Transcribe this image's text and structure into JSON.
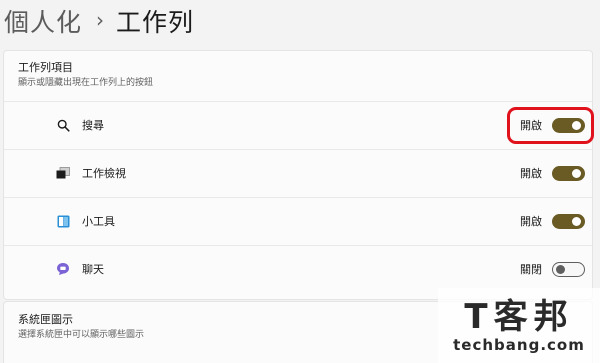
{
  "breadcrumb": {
    "parent": "個人化",
    "separator": "›",
    "current": "工作列"
  },
  "taskbar_items": {
    "title": "工作列項目",
    "description": "顯示或隱藏出現在工作列上的按鈕",
    "rows": [
      {
        "label": "搜尋",
        "icon": "search-icon",
        "state": "開啟",
        "on": true
      },
      {
        "label": "工作檢視",
        "icon": "task-view-icon",
        "state": "開啟",
        "on": true
      },
      {
        "label": "小工具",
        "icon": "widgets-icon",
        "state": "開啟",
        "on": true
      },
      {
        "label": "聊天",
        "icon": "chat-icon",
        "state": "關閉",
        "on": false
      }
    ]
  },
  "system_tray": {
    "title": "系統匣圖示",
    "description": "選擇系統匣中可以顯示哪些圖示"
  },
  "watermark": {
    "logo": "T客邦",
    "site": "techbang.com"
  },
  "colors": {
    "accent": "#6a5a24",
    "highlight": "#e0121c"
  }
}
